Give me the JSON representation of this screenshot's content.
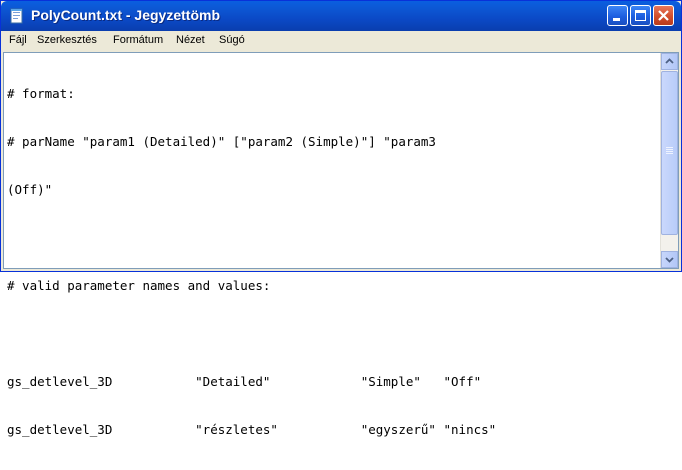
{
  "window": {
    "title": "PolyCount.txt - Jegyzettömb"
  },
  "menu": {
    "items": [
      "Fájl",
      "Szerkesztés",
      "Formátum",
      "Nézet",
      "Súgó"
    ]
  },
  "editor": {
    "lines": [
      "# format:",
      "# parName \"param1 (Detailed)\" [\"param2 (Simple)\"] \"param3",
      "(Off)\"",
      "",
      "# valid parameter names and values:",
      "",
      "gs_detlevel_3D           \"Detailed\"            \"Simple\"   \"Off\"",
      "gs_detlevel_3D           \"részletes\"           \"egyszerű\" \"nincs\""
    ]
  },
  "icons": {
    "app": "notepad-icon",
    "minimize": "minimize-icon",
    "maximize": "maximize-icon",
    "close": "close-icon",
    "scroll_up": "scroll-up-arrow-icon",
    "scroll_down": "scroll-down-arrow-icon"
  }
}
